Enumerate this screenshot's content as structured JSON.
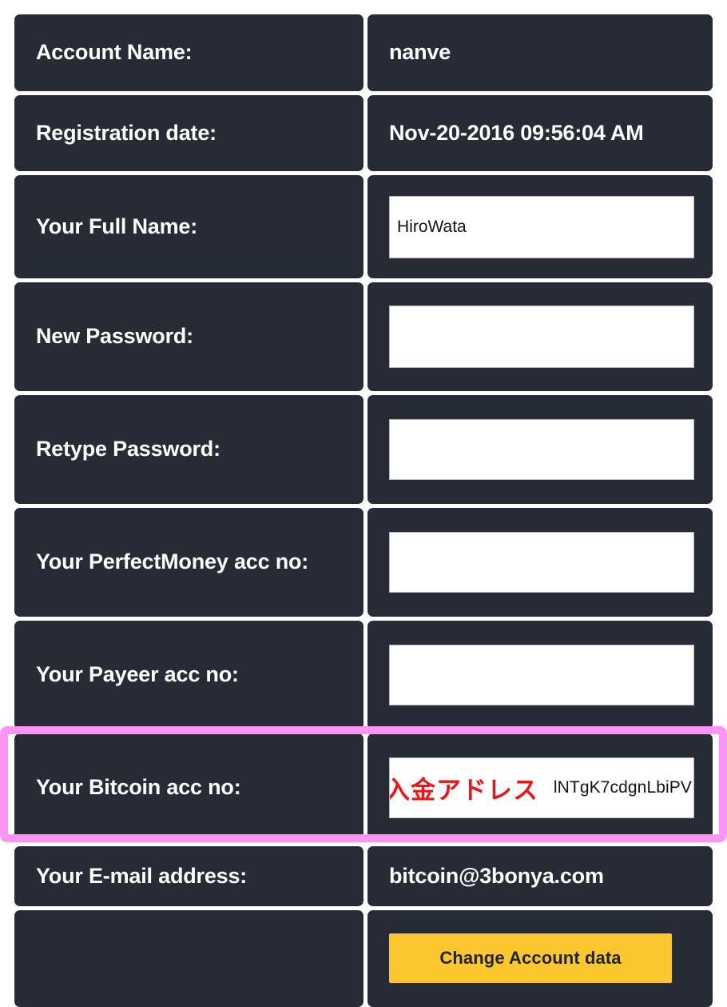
{
  "form": {
    "rows": [
      {
        "label": "Account Name:",
        "kind": "static",
        "value": "nanve"
      },
      {
        "label": "Registration date:",
        "kind": "static",
        "value": "Nov-20-2016 09:56:04 AM"
      },
      {
        "label": "Your Full Name:",
        "kind": "input",
        "value": "HiroWata",
        "placeholder": ""
      },
      {
        "label": "New Password:",
        "kind": "input",
        "value": "",
        "placeholder": ""
      },
      {
        "label": "Retype Password:",
        "kind": "input",
        "value": "",
        "placeholder": ""
      },
      {
        "label": "Your PerfectMoney acc no:",
        "kind": "input",
        "value": "",
        "placeholder": ""
      },
      {
        "label": "Your Payeer acc no:",
        "kind": "input",
        "value": "",
        "placeholder": ""
      },
      {
        "label": "Your Bitcoin acc no:",
        "kind": "bitcoin-input",
        "value": "lNTgK7cdgnLbiPV",
        "placeholder": "",
        "annotation": "入金アドレス",
        "highlighted": true
      },
      {
        "label": "Your E-mail address:",
        "kind": "static",
        "value": "bitcoin@3bonya.com"
      },
      {
        "label": "",
        "kind": "submit",
        "value": "Change Account data"
      }
    ]
  },
  "colors": {
    "cell_background": "#272B36",
    "page_background": "#FFFFFF",
    "text": "#FFFFFF",
    "highlight_border": "#FC94F5",
    "button_background": "#FBC62E",
    "button_text": "#212529",
    "annotation_text": "#E8171A"
  }
}
